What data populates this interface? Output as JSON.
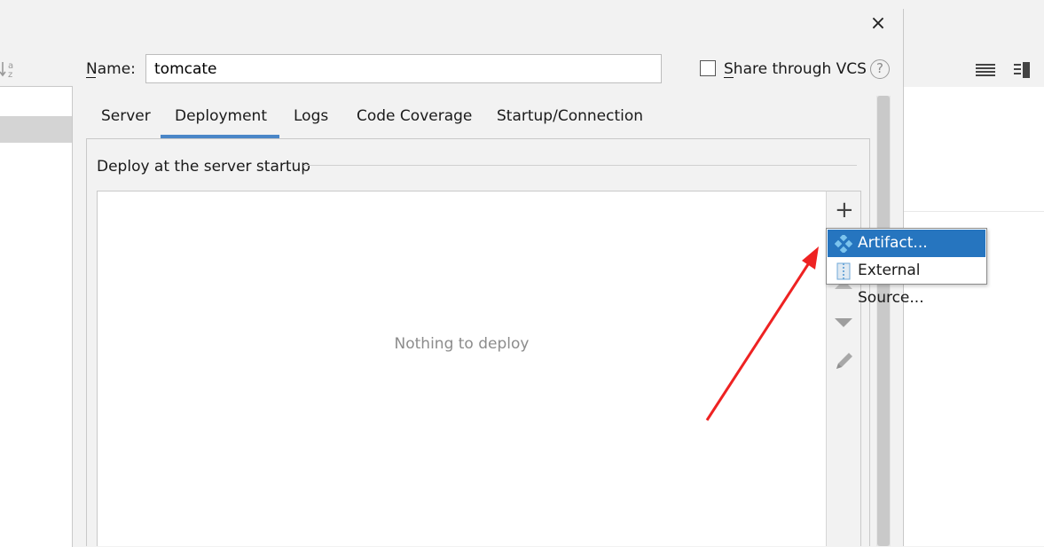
{
  "dialog": {
    "name_label": "Name:",
    "name_value": "tomcate",
    "share_vcs_label": "Share through VCS",
    "share_vcs_checked": false,
    "help_symbol": "?",
    "close_symbol": "×"
  },
  "tabs": [
    {
      "label": "Server",
      "active": false
    },
    {
      "label": "Deployment",
      "active": true
    },
    {
      "label": "Logs",
      "active": false
    },
    {
      "label": "Code Coverage",
      "active": false
    },
    {
      "label": "Startup/Connection",
      "active": false
    }
  ],
  "deployment": {
    "section_title": "Deploy at the server startup",
    "empty_text": "Nothing to deploy",
    "toolbar": {
      "add_symbol": "+",
      "icons": [
        "plus-icon",
        "move-up-icon",
        "move-down-icon",
        "edit-pencil-icon"
      ]
    }
  },
  "popup_menu": {
    "items": [
      {
        "label": "Artifact...",
        "icon": "artifact-icon",
        "selected": true
      },
      {
        "label": "External Source...",
        "icon": "external-source-icon",
        "selected": false
      }
    ]
  },
  "colors": {
    "accent": "#2675bf",
    "tab_underline": "#4a86c7",
    "annotation_arrow": "#ee2222",
    "artifact_icon": "#3d9ad6"
  }
}
